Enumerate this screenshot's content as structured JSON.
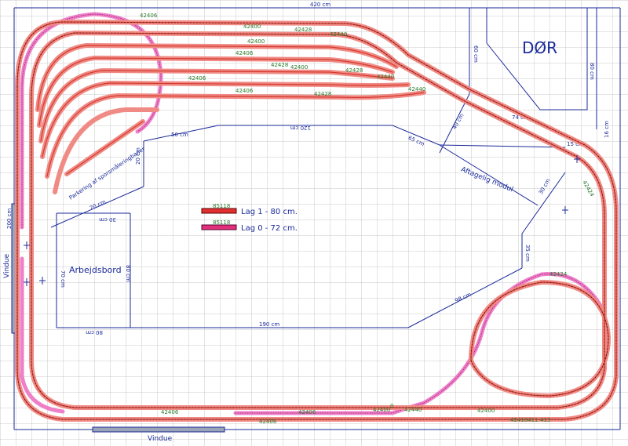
{
  "plan": {
    "total_width": "420 cm",
    "door_label": "DØR",
    "door_dim_left": "60 cm",
    "door_dim_right": "80 cm",
    "window_left": "Vindue",
    "window_bottom": "Vindue",
    "room_dim_left": "200 cm",
    "module_label": "Aftagelig modul",
    "parking_label": "Parkering af sporsmåleringbaner",
    "workbench_label": "Arbejdsbord",
    "workbench_dims": [
      "30 cm",
      "70 cm",
      "80 cm",
      "80 cm"
    ],
    "board_dims": {
      "top": "120 cm",
      "upper_left": "50 cm",
      "left_vertical": "20 cm",
      "diagonal_left": "20 cm",
      "bottom": "190 cm",
      "diag_right_low": "98 cm",
      "right_vertical": "35 cm",
      "module_diag_top": "65 cm",
      "module_right": "30 cm",
      "module_inner": "40 cm",
      "corner_a": "74 cm",
      "corner_b": "15 cm",
      "corner_c": "16 cm"
    }
  },
  "legend": {
    "items": [
      {
        "code": "85118",
        "label": "Lag 1 - 80 cm.",
        "color": "#e03030"
      },
      {
        "code": "85118",
        "label": "Lag 0 - 72 cm.",
        "color": "#e0307a"
      }
    ]
  },
  "track_codes": [
    "42400",
    "42406",
    "42428",
    "42440",
    "42424",
    "42410",
    "411",
    "413",
    "0"
  ],
  "colors": {
    "track_red": "#f08a84",
    "track_red_edge": "#d43a30",
    "track_pink": "#ee7fc8",
    "grid": "#c9c9c9",
    "annotation": "#1a2a9a"
  }
}
